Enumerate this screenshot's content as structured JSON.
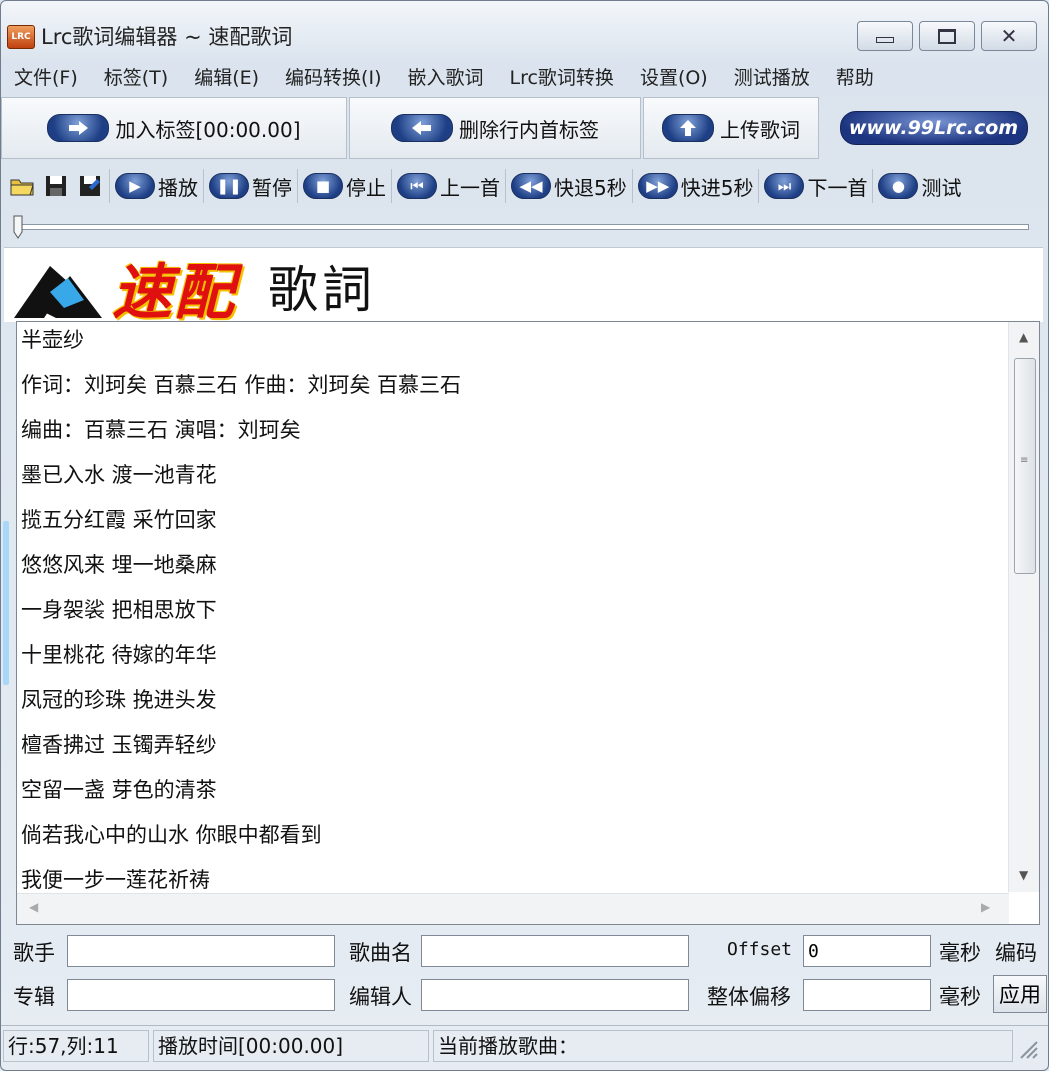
{
  "window": {
    "title": "Lrc歌词编辑器 ~ 速配歌词",
    "icon_text": "LRC"
  },
  "menu": [
    "文件(F)",
    "标签(T)",
    "编辑(E)",
    "编码转换(I)",
    "嵌入歌词",
    "Lrc歌词转换",
    "设置(O)",
    "测试播放",
    "帮助"
  ],
  "toolbar1": {
    "add_tag": "加入标签[00:00.00]",
    "delete_tag": "删除行内首标签",
    "upload": "上传歌词",
    "site": "www.99Lrc.com"
  },
  "toolbar2": {
    "play": "播放",
    "pause": "暂停",
    "stop": "停止",
    "prev": "上一首",
    "rewind": "快退5秒",
    "forward": "快进5秒",
    "next": "下一首",
    "test": "测试"
  },
  "banner": {
    "brand_red": "速配",
    "brand_black": "歌詞"
  },
  "lyrics": [
    "半壶纱",
    "作词：刘珂矣  百慕三石  作曲：刘珂矣  百慕三石",
    "编曲：百慕三石  演唱：刘珂矣",
    "墨已入水  渡一池青花",
    "揽五分红霞  采竹回家",
    "悠悠风来  埋一地桑麻",
    "一身袈裟  把相思放下",
    "十里桃花  待嫁的年华",
    "凤冠的珍珠  挽进头发",
    "檀香拂过  玉镯弄轻纱",
    "空留一盏  芽色的清茶",
    "倘若我心中的山水  你眼中都看到",
    "我便一步一莲花祈祷"
  ],
  "fields": {
    "singer_label": "歌手",
    "singer_value": "",
    "song_label": "歌曲名",
    "song_value": "",
    "offset_label": "Offset",
    "offset_value": "0",
    "ms_label": "毫秒",
    "encoding_label": "编码",
    "album_label": "专辑",
    "album_value": "",
    "editor_label": "编辑人",
    "editor_value": "",
    "global_offset_label": "整体偏移",
    "global_offset_value": "",
    "ms_label2": "毫秒",
    "apply": "应用"
  },
  "status": {
    "position": "行:57,列:11",
    "play_time": "播放时间[00:00.00]",
    "current_song": "当前播放歌曲："
  },
  "colors": {
    "accent_blue": "#1e3f85",
    "brand_red": "#e01010",
    "brand_yellow": "#f5c000"
  }
}
